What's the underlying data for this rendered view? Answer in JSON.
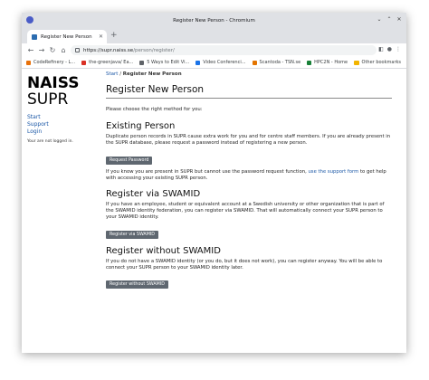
{
  "window": {
    "title": "Register New Person - Chromium"
  },
  "tab": {
    "label": "Register New Person"
  },
  "toolbar": {
    "url_host": "https://supr.naiss.se",
    "url_path": "/person/register/"
  },
  "bookmarks": {
    "items": [
      {
        "label": "CodeRefinery - L...",
        "color": "#e8710a"
      },
      {
        "label": "the-greenjava/ Ea...",
        "color": "#d93025"
      },
      {
        "label": "5 Ways to Edit Vi...",
        "color": "#5f6368"
      },
      {
        "label": "Video Conferenci...",
        "color": "#1a73e8"
      },
      {
        "label": "Scantoda - TSN.se",
        "color": "#e37400"
      },
      {
        "label": "HPC2N - Home",
        "color": "#188038"
      }
    ],
    "other": "Other bookmarks"
  },
  "sidebar": {
    "logo_line1": "NAISS",
    "logo_line2": "SUPR",
    "nav": [
      "Start",
      "Support",
      "Login"
    ],
    "status": "Your are not logged in."
  },
  "main": {
    "breadcrumb_start": "Start",
    "breadcrumb_sep": "/",
    "breadcrumb_current": "Register New Person",
    "title": "Register New Person",
    "intro": "Please choose the right method for you:",
    "existing": {
      "heading": "Existing Person",
      "text": "Duplicate person records in SUPR cause extra work for you and for centre staff members. If you are already present in the SUPR database, please request a password instead of registering a new person.",
      "button": "Request Password",
      "support_before": "If you know you are present in SUPR but cannot use the password request function,",
      "support_link": "use the support form",
      "support_after": "to get help with accessing your existing SUPR person."
    },
    "swamid": {
      "heading": "Register via SWAMID",
      "text": "If you have an employee, student or equivalent account at a Swedish university or other organization that is part of the SWAMID identity federation, you can register via SWAMID. That will automatically connect your SUPR person to your SWAMID identity.",
      "button": "Register via SWAMID"
    },
    "without": {
      "heading": "Register without SWAMID",
      "text": "If you do not have a SWAMID identity (or you do, but it does not work), you can register anyway. You will be able to connect your SUPR person to your SWAMID identity later.",
      "button": "Register without SWAMID"
    }
  }
}
